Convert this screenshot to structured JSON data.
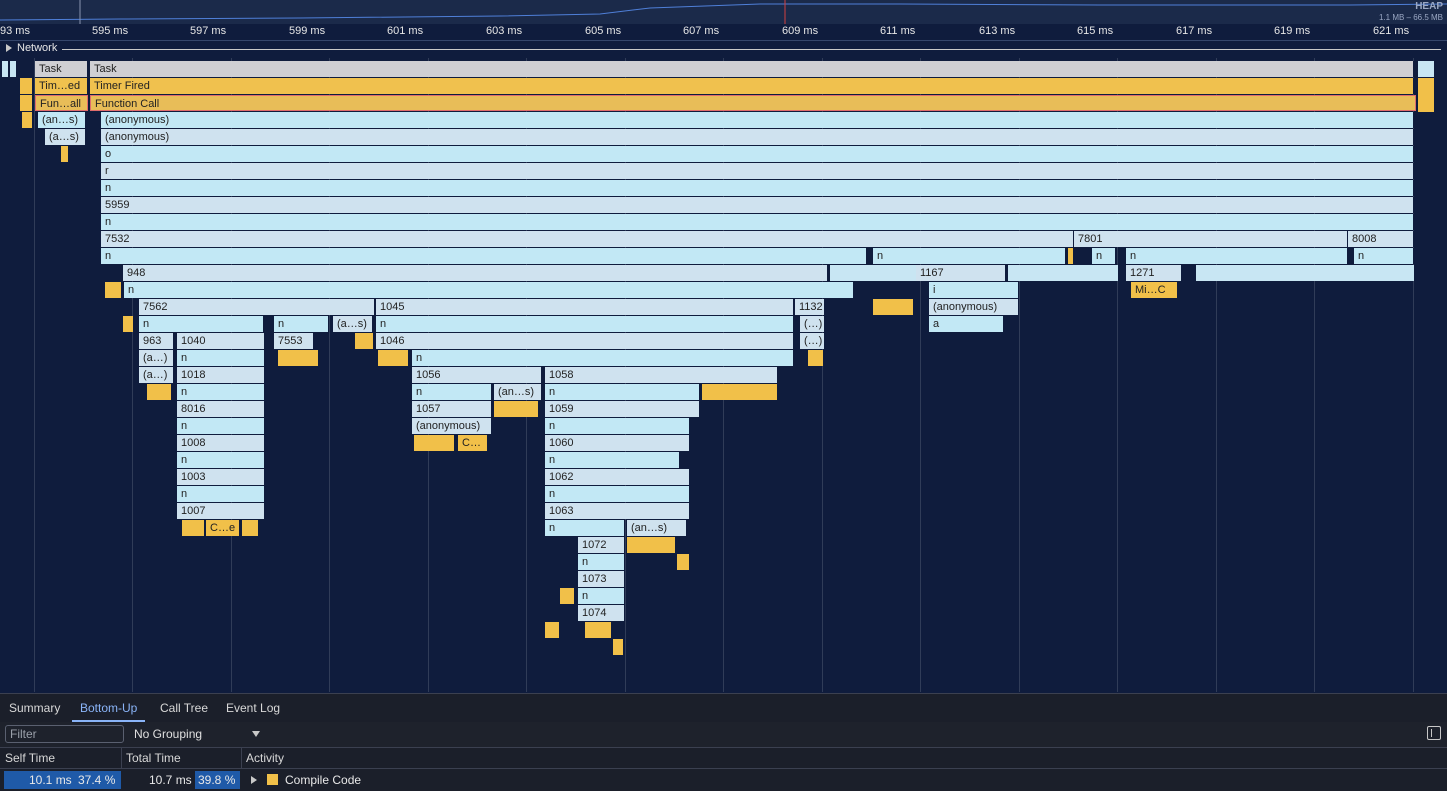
{
  "overview": {
    "heap_label": "HEAP",
    "heap_range": "1.1 MB – 66.5 MB"
  },
  "ruler": {
    "ticks": [
      "93 ms",
      "595 ms",
      "597 ms",
      "599 ms",
      "601 ms",
      "603 ms",
      "605 ms",
      "607 ms",
      "609 ms",
      "611 ms",
      "613 ms",
      "615 ms",
      "617 ms",
      "619 ms",
      "621 ms"
    ]
  },
  "network": {
    "label": "Network"
  },
  "flame": {
    "task_short": "Task",
    "task_main": "Task",
    "timer_short": "Tim…ed",
    "timer_main": "Timer Fired",
    "fcall_short": "Fun…all",
    "fcall_main": "Function Call",
    "anon_short1": "(an…s)",
    "anon_short2": "(a…s)",
    "anon_main1": "(anonymous)",
    "anon_main2": "(anonymous)",
    "o": "o",
    "r": "r",
    "n1": "n",
    "f5959": "5959",
    "n2": "n",
    "f7532": "7532",
    "f7801": "7801",
    "f8008": "8008",
    "n3": "n",
    "n3b": "n",
    "n3c": "n",
    "n3d": "n",
    "n3e": "n",
    "f948": "948",
    "f1167": "1167",
    "f1271": "1271",
    "n4": "n",
    "i": "i",
    "mi_c": "Mi…C",
    "f7562": "7562",
    "f1045": "1045",
    "f1132": "1132",
    "anon_mid": "(anonymous)",
    "n5": "n",
    "n5b": "n",
    "a_short": "(a…s)",
    "n5c": "n",
    "dots1": "(…)",
    "a": "a",
    "f963": "963",
    "f1040": "1040",
    "f7553": "7553",
    "f1046": "1046",
    "dots2": "(…)",
    "a1": "(a…)",
    "n6": "n",
    "n6b": "n",
    "a2": "(a…)",
    "f1018": "1018",
    "f1056": "1056",
    "f1058": "1058",
    "n7": "n",
    "n7b": "n",
    "an_s": "(an…s)",
    "n7c": "n",
    "f8016": "8016",
    "f1057": "1057",
    "f1059": "1059",
    "n8": "n",
    "anon_low": "(anonymous)",
    "n8b": "n",
    "f1008": "1008",
    "c_short": "C…",
    "f1060": "1060",
    "n9": "n",
    "n9b": "n",
    "f1003": "1003",
    "f1062": "1062",
    "n10": "n",
    "n10b": "n",
    "f1007": "1007",
    "f1063": "1063",
    "c_e": "C…e",
    "n11": "n",
    "an_s2": "(an…s)",
    "f1072": "1072",
    "n12": "n",
    "f1073": "1073",
    "n13": "n",
    "f1074": "1074"
  },
  "tabs": {
    "summary": "Summary",
    "bottom_up": "Bottom-Up",
    "call_tree": "Call Tree",
    "event_log": "Event Log"
  },
  "filterbar": {
    "filter_placeholder": "Filter",
    "grouping": "No Grouping"
  },
  "table": {
    "headers": {
      "self_time": "Self Time",
      "total_time": "Total Time",
      "activity": "Activity"
    },
    "rows": [
      {
        "self_time": "10.1 ms",
        "self_pct": "37.4 %",
        "self_fraction": 0.374,
        "total_time": "10.7 ms",
        "total_pct": "39.8 %",
        "total_fraction": 0.398,
        "activity": "Compile Code",
        "color": "#f1c049"
      }
    ]
  }
}
